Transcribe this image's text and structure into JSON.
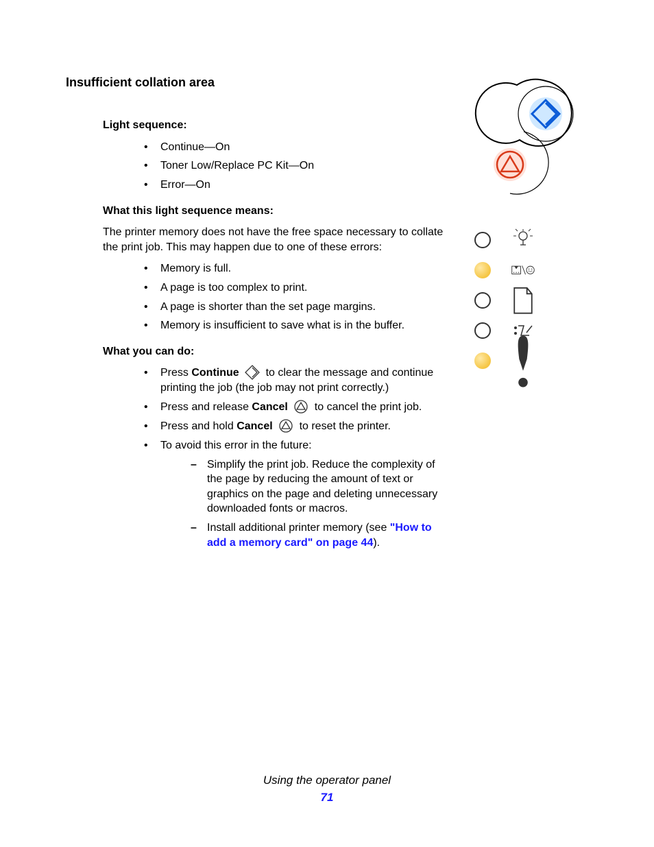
{
  "title": "Insufficient collation area",
  "sections": {
    "lightSequence": {
      "heading": "Light sequence:",
      "items": [
        "Continue—On",
        "Toner Low/Replace PC Kit—On",
        "Error—On"
      ]
    },
    "means": {
      "heading": "What this light sequence means:",
      "para": "The printer memory does not have the free space necessary to collate the print job. This may happen due to one of these errors:",
      "items": [
        "Memory is full.",
        "A page is too complex to print.",
        "A page is shorter than the set page margins.",
        "Memory is insufficient to save what is in the buffer."
      ]
    },
    "whatDo": {
      "heading": "What you can do:",
      "item1_a": "Press ",
      "item1_b": "Continue",
      "item1_c": " to clear the message and continue printing the job (the job may not print correctly.)",
      "item2_a": "Press and release ",
      "item2_b": "Cancel",
      "item2_c": " to cancel the print job.",
      "item3_a": "Press and hold ",
      "item3_b": "Cancel",
      "item3_c": " to reset the printer.",
      "item4": "To avoid this error in the future:",
      "sub1": "Simplify the print job. Reduce the complexity of the page by reducing the amount of text or graphics on the page and deleting unnecessary downloaded fonts or macros.",
      "sub2_a": "Install additional printer memory (see ",
      "sub2_link": "\"How to add a memory card\" on page 44",
      "sub2_c": ")."
    }
  },
  "statusLights": [
    {
      "on": false,
      "icon": "ready-light-icon"
    },
    {
      "on": true,
      "icon": "toner-low-icon"
    },
    {
      "on": false,
      "icon": "load-paper-icon"
    },
    {
      "on": false,
      "icon": "paper-jam-icon"
    },
    {
      "on": true,
      "icon": "error-icon"
    }
  ],
  "footer": {
    "text": "Using the operator panel",
    "page": "71"
  }
}
